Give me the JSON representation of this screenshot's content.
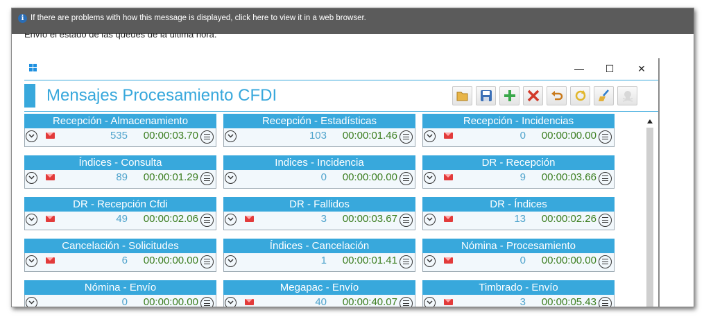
{
  "infobar": {
    "text": "If there are problems with how this message is displayed, click here to view it in a web browser."
  },
  "message": {
    "body": "Envío el estado de las queues de la última hora."
  },
  "window": {
    "title": "Mensajes Procesamiento CFDI",
    "controls": {
      "minimize": "—",
      "maximize": "☐",
      "close": "✕"
    }
  },
  "toolbar": [
    "folder-open-icon",
    "save-icon",
    "add-icon",
    "delete-icon",
    "undo-icon",
    "refresh-icon",
    "clean-icon",
    "skull-icon"
  ],
  "colors": {
    "accent": "#38a8dc",
    "count": "#4ea3cc",
    "time": "#3a7d1e",
    "mail": "#e23b3b"
  },
  "cards": [
    {
      "title": "Recepción - Almacenamiento",
      "count": "535",
      "time": "00:00:03.70",
      "mail": true
    },
    {
      "title": "Recepción - Estadísticas",
      "count": "103",
      "time": "00:00:01.46",
      "mail": false
    },
    {
      "title": "Recepción - Incidencias",
      "count": "0",
      "time": "00:00:00.00",
      "mail": true
    },
    {
      "title": "Índices - Consulta",
      "count": "89",
      "time": "00:00:01.29",
      "mail": true
    },
    {
      "title": "Indices - Incidencia",
      "count": "0",
      "time": "00:00:00.00",
      "mail": false
    },
    {
      "title": "DR - Recepción",
      "count": "9",
      "time": "00:00:03.66",
      "mail": true
    },
    {
      "title": "DR - Recepción Cfdi",
      "count": "49",
      "time": "00:00:02.06",
      "mail": true
    },
    {
      "title": "DR - Fallidos",
      "count": "3",
      "time": "00:00:03.67",
      "mail": true
    },
    {
      "title": "DR - Índices",
      "count": "13",
      "time": "00:00:02.26",
      "mail": true
    },
    {
      "title": "Cancelación - Solicitudes",
      "count": "6",
      "time": "00:00:00.00",
      "mail": true
    },
    {
      "title": "Índices - Cancelación",
      "count": "1",
      "time": "00:00:01.41",
      "mail": false
    },
    {
      "title": "Nómina - Procesamiento",
      "count": "0",
      "time": "00:00:00.00",
      "mail": true
    },
    {
      "title": "Nómina - Envío",
      "count": "0",
      "time": "00:00:00.00",
      "mail": false
    },
    {
      "title": "Megapac - Envío",
      "count": "40",
      "time": "00:00:40.07",
      "mail": true
    },
    {
      "title": "Timbrado - Envío",
      "count": "3",
      "time": "00:00:05.43",
      "mail": true
    }
  ]
}
